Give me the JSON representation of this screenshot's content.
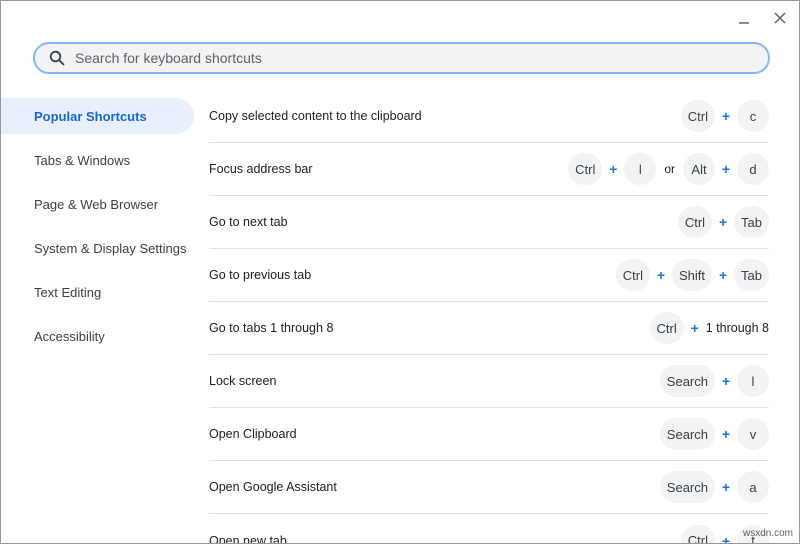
{
  "search": {
    "placeholder": "Search for keyboard shortcuts"
  },
  "sidebar": {
    "items": [
      {
        "label": "Popular Shortcuts"
      },
      {
        "label": "Tabs & Windows"
      },
      {
        "label": "Page & Web Browser"
      },
      {
        "label": "System & Display Settings"
      },
      {
        "label": "Text Editing"
      },
      {
        "label": "Accessibility"
      }
    ]
  },
  "shortcuts": [
    {
      "name": "Copy selected content to the clipboard",
      "k1": "Ctrl",
      "k2": "c"
    },
    {
      "name": "Focus address bar",
      "k1": "Ctrl",
      "k2": "l",
      "or": "or",
      "k3": "Alt",
      "k4": "d"
    },
    {
      "name": "Go to next tab",
      "k1": "Ctrl",
      "k2": "Tab"
    },
    {
      "name": "Go to previous tab",
      "k1": "Ctrl",
      "k2": "Shift",
      "k3": "Tab"
    },
    {
      "name": "Go to tabs 1 through 8",
      "k1": "Ctrl",
      "k2": "1 through 8"
    },
    {
      "name": "Lock screen",
      "k1": "Search",
      "k2": "l"
    },
    {
      "name": "Open Clipboard",
      "k1": "Search",
      "k2": "v"
    },
    {
      "name": "Open Google Assistant",
      "k1": "Search",
      "k2": "a"
    },
    {
      "name": "Open new tab",
      "k1": "Ctrl",
      "k2": "t"
    }
  ],
  "symbols": {
    "plus": "+"
  },
  "watermark": "wsxdn.com",
  "colors": {
    "accent": "#1a73e8",
    "active_bg": "#e8f0fe",
    "key_bg": "#f1f3f4",
    "search_border": "#8ab4f8"
  }
}
